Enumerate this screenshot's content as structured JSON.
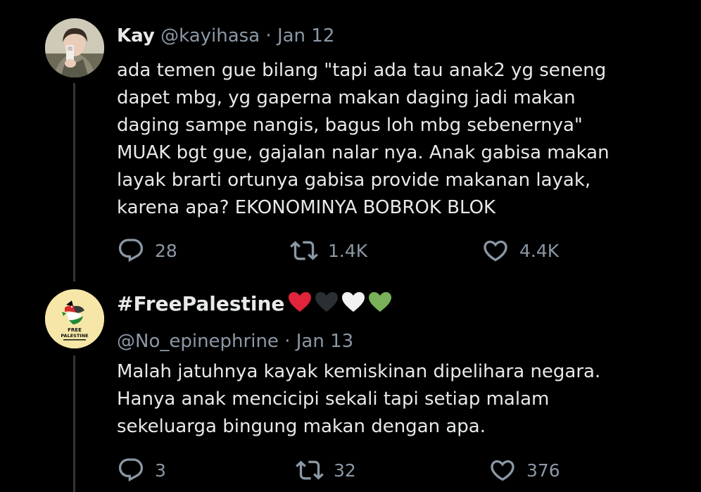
{
  "tweets": [
    {
      "name": "Kay",
      "handle": "@kayihasa",
      "separator": "·",
      "date": "Jan 12",
      "text_lines": [
        "ada temen gue bilang \"tapi ada tau anak2 yg seneng",
        "dapet mbg, yg gaperna makan daging jadi makan",
        "daging sampe nangis, bagus loh mbg sebenernya\"",
        "MUAK bgt gue, gajalan nalar nya. Anak gabisa makan",
        "layak brarti ortunya gabisa provide makanan layak,",
        "karena apa? EKONOMINYA BOBROK BLOK"
      ],
      "replies": "28",
      "retweets": "1.4K",
      "likes": "4.4K",
      "icons": {
        "reply": "reply-icon",
        "retweet": "retweet-icon",
        "like": "like-icon"
      }
    },
    {
      "name": "#FreePalestine",
      "name_emoji": [
        "red-heart",
        "black-heart",
        "white-heart",
        "green-heart"
      ],
      "handle": "@No_epinephrine",
      "separator": "·",
      "date": "Jan 13",
      "avatar_text": [
        "FREE",
        "PALESTINE"
      ],
      "text_lines": [
        "Malah jatuhnya kayak kemiskinan dipelihara negara.",
        "Hanya anak mencicipi sekali tapi setiap malam",
        "sekeluarga bingung makan dengan apa."
      ],
      "replies": "3",
      "retweets": "32",
      "likes": "376",
      "icons": {
        "reply": "reply-icon",
        "retweet": "retweet-icon",
        "like": "like-icon"
      }
    }
  ],
  "colors": {
    "background": "#000000",
    "text": "#e7e9ea",
    "secondary": "#8b98a5",
    "thread_line": "#333639",
    "heart_red": "#e0243a",
    "heart_black": "#292f33",
    "heart_white": "#f2f2f2",
    "heart_green": "#78b159"
  }
}
